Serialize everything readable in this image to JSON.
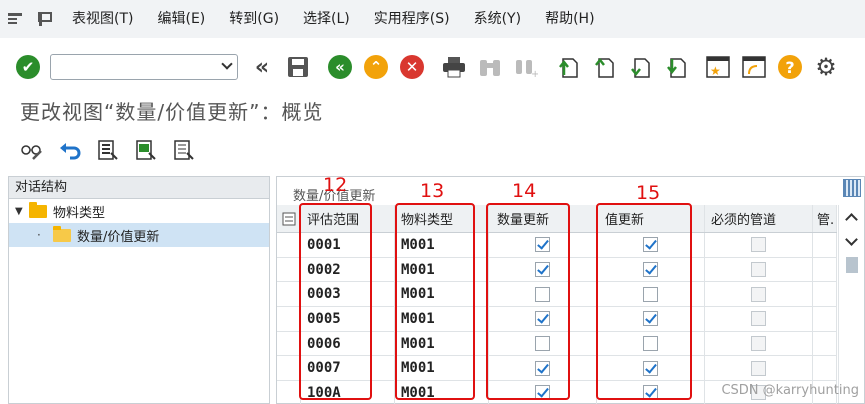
{
  "menu": {
    "items": [
      "表视图(T)",
      "编辑(E)",
      "转到(G)",
      "选择(L)",
      "实用程序(S)",
      "系统(Y)",
      "帮助(H)"
    ]
  },
  "toolbar": {
    "command_field_value": ""
  },
  "page_title": "更改视图“数量/价值更新”：概览",
  "tree": {
    "header": "对话结构",
    "root": "物料类型",
    "child": "数量/价值更新"
  },
  "table": {
    "title": "数量/价值更新",
    "columns": [
      "评估范围",
      "物料类型",
      "数量更新",
      "值更新",
      "必须的管道",
      "管."
    ],
    "rows": [
      {
        "area": "0001",
        "type": "M001",
        "qty": true,
        "val": true,
        "pipe": false
      },
      {
        "area": "0002",
        "type": "M001",
        "qty": true,
        "val": true,
        "pipe": false
      },
      {
        "area": "0003",
        "type": "M001",
        "qty": false,
        "val": false,
        "pipe": false
      },
      {
        "area": "0005",
        "type": "M001",
        "qty": true,
        "val": true,
        "pipe": false
      },
      {
        "area": "0006",
        "type": "M001",
        "qty": false,
        "val": false,
        "pipe": false
      },
      {
        "area": "0007",
        "type": "M001",
        "qty": true,
        "val": true,
        "pipe": false
      },
      {
        "area": "100A",
        "type": "M001",
        "qty": true,
        "val": true,
        "pipe": false
      }
    ]
  },
  "annotations": [
    "12",
    "13",
    "14",
    "15"
  ],
  "watermark": "CSDN @karryhunting",
  "colors": {
    "accent_red": "#e01010",
    "check_blue": "#1f73c9",
    "ok_green": "#2b8d2b"
  }
}
